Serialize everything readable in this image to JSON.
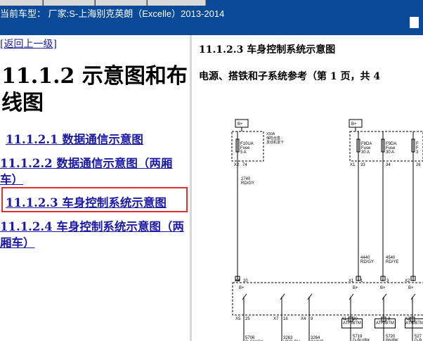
{
  "header": {
    "title": "当前车型：  厂家:S-上海别克英朗（Excelle）2013-2014"
  },
  "sidebar": {
    "back_link": "[返回上一级]",
    "heading": "11.1.2 示意图和布线图",
    "items": [
      {
        "label": "11.1.2.1 数据通信示意图"
      },
      {
        "label": "11.1.2.2 数据通信示意图（两厢车）"
      },
      {
        "label": "11.1.2.3 车身控制系统示意图"
      },
      {
        "label": "11.1.2.4 车身控制系统示意图（两厢车）"
      }
    ]
  },
  "content": {
    "title": "11.1.2.3 车身控制系统示意图",
    "subtitle": "电源、搭铁和子系统参考（第 1 页，共 4",
    "diagram": {
      "bplus_1": "B+",
      "bplus_2": "B+",
      "fuse1_name": "F10UA",
      "fuse1_type": "Fuse",
      "fuse1_rating": "5 A",
      "fuse1_note1": "X50A",
      "fuse1_note2": "保险丝盒 -",
      "fuse1_note3": "发动机罩下",
      "fuse2_name": "F8DA",
      "fuse2_type": "Fuse",
      "fuse2_rating": "30 A",
      "fuse3_name": "F9DA",
      "fuse3_type": "Fuse",
      "fuse3_rating": "30 A",
      "fuse4_name": "F",
      "fuse4_type": "F",
      "fuse4_rating": "3",
      "c_x2": "X2",
      "c_74": "74",
      "c_x1a": "X1",
      "c_33": "33",
      "c_34": "34",
      "c_26": "26",
      "wire1_num": "2740",
      "wire1_color": "RD/GY",
      "wire2_num": "4440",
      "wire2_color": "RD/GY",
      "wire3_num": "4540",
      "wire3_color": "RD/YE",
      "c_x4": "X4",
      "c_20a": "20",
      "c_x1b": "X1",
      "c_1": "1",
      "c_3": "3",
      "c_x2b": "X2",
      "bp_a": "B+",
      "bp_b": "B+",
      "bp_c": "B+",
      "bp_d": "B+",
      "c_x5": "X5",
      "c_25": "25",
      "c_x7": "X7",
      "c_16": "16",
      "c_x4b": "X4",
      "c_9": "9",
      "c_x1c": "X1",
      "c_20b": "20",
      "c_8": "8",
      "c_x2c": "X2",
      "bw1_num": "5706",
      "bw1_color": "D-GN/GY",
      "bw2_num": "3263",
      "bw2_color": "VT/D-BU",
      "bw3_num": "3264",
      "bw3_color": "GY/VT",
      "bw4_num": "5719",
      "bw4_color": "D-BU/BK",
      "bw5_num": "5720",
      "bw5_color": "BN/BK",
      "bw6_num": "527",
      "bw6_color": "D-B",
      "ath1": "ATH/BTM",
      "ath2": "ATH/BTM",
      "ath3": "ATH/BTM",
      "ath4": "ATH"
    }
  }
}
